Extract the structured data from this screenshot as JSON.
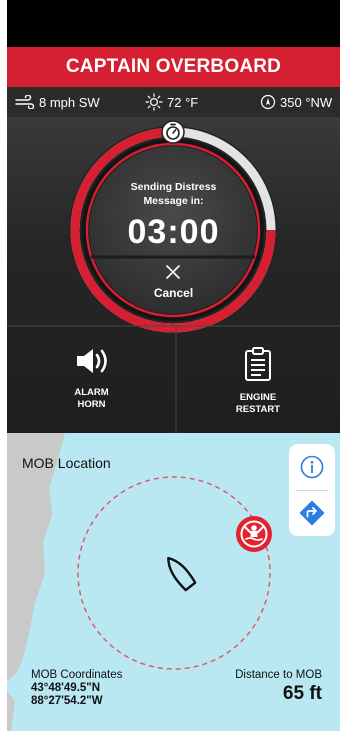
{
  "header": {
    "title": "CAPTAIN OVERBOARD"
  },
  "weather": {
    "wind": {
      "icon": "wind-icon",
      "text": "8 mph SW"
    },
    "temperature": {
      "icon": "sun-icon",
      "text": "72 °F"
    },
    "heading": {
      "icon": "compass-icon",
      "text": "350 °NW"
    }
  },
  "countdown": {
    "message_line1": "Sending Distress",
    "message_line2": "Message in:",
    "time": "03:00",
    "cancel_label": "Cancel",
    "progress_fraction": 0.75
  },
  "actions": [
    {
      "icon": "speaker-icon",
      "line1": "ALARM",
      "line2": "HORN"
    },
    {
      "icon": "clipboard-icon",
      "line1": "ENGINE",
      "line2": "RESTART"
    }
  ],
  "map": {
    "title": "MOB Location",
    "coordinates_label": "MOB Coordinates",
    "latitude": "43°48'49.5\"N",
    "longitude": "88°27'54.2\"W",
    "distance_label": "Distance to MOB",
    "distance_value": "65 ft"
  },
  "colors": {
    "accent_red": "#d61f30",
    "water": "#b9e8f3",
    "land": "#c9c9c9",
    "buttons_blue": "#2a7de1"
  }
}
